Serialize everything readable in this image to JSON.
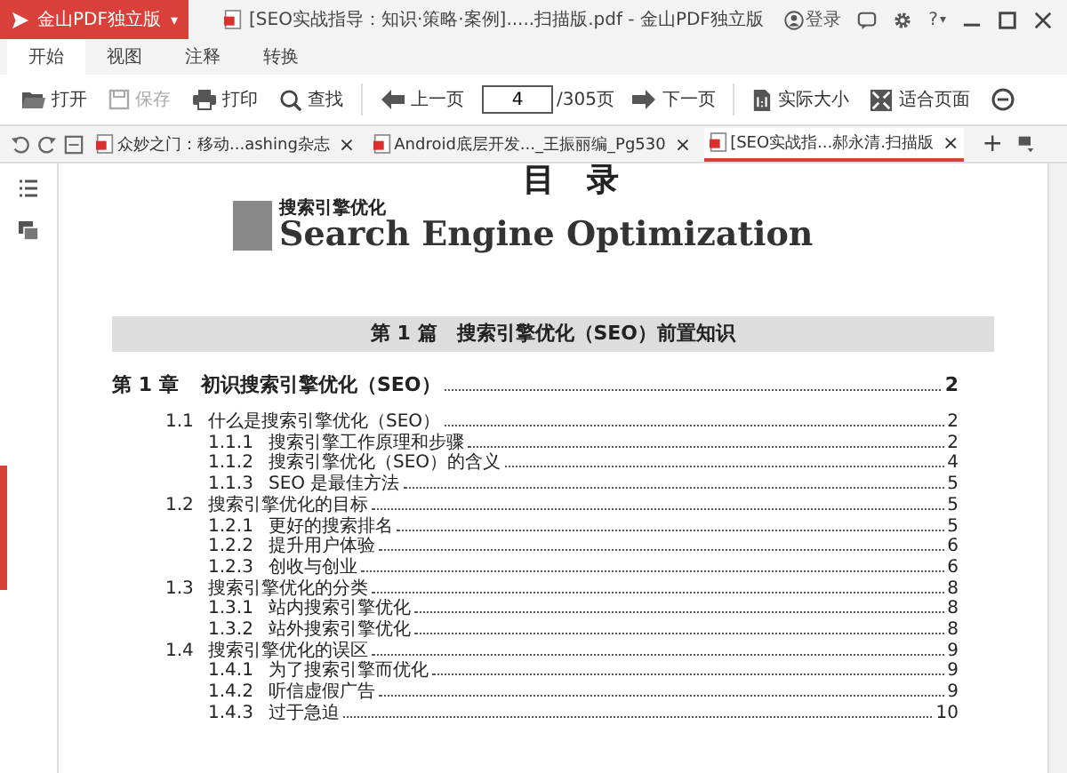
{
  "app_button": {
    "label": "金山PDF独立版",
    "caret": "▾"
  },
  "window": {
    "title": "[SEO实战指导：知识·策略·案例].....扫描版.pdf - 金山PDF独立版",
    "login": "登录",
    "help": "?",
    "help_caret": "▾"
  },
  "ribbon_tabs": [
    {
      "label": "开始",
      "selected": true
    },
    {
      "label": "视图",
      "selected": false
    },
    {
      "label": "注释",
      "selected": false
    },
    {
      "label": "转换",
      "selected": false
    }
  ],
  "toolbar": [
    {
      "kind": "open",
      "label": "打开",
      "disabled": false
    },
    {
      "kind": "save",
      "label": "保存",
      "disabled": true
    },
    {
      "kind": "print",
      "label": "打印",
      "disabled": false
    },
    {
      "kind": "find",
      "label": "查找",
      "disabled": false
    },
    {
      "kind": "prev",
      "label": "上一页",
      "disabled": false
    },
    {
      "kind": "page",
      "value": "4",
      "total": "/305页"
    },
    {
      "kind": "next",
      "label": "下一页",
      "disabled": false
    },
    {
      "kind": "actual",
      "label": "实际大小",
      "disabled": false
    },
    {
      "kind": "fit",
      "label": "适合页面",
      "disabled": false
    },
    {
      "kind": "zoomout"
    }
  ],
  "doc_tabs": [
    {
      "label": "众妙之门：移动...ashing杂志",
      "close": "×",
      "selected": false
    },
    {
      "label": "Android底层开发..._王振丽编_Pg530",
      "close": "×",
      "selected": false
    },
    {
      "label": "[SEO实战指...郝永清.扫描版",
      "close": "×",
      "selected": true
    }
  ],
  "new_tab": "+",
  "page": {
    "heading": "目　录",
    "banner_small": "搜索引擎优化",
    "banner_large": "Search Engine Optimization",
    "part": "第 1 篇　搜索引擎优化（SEO）前置知识",
    "toc": [
      {
        "number": "第 1 章",
        "title": "初识搜索引擎优化（SEO）",
        "page": "2",
        "children": [
          {
            "number": "1.1",
            "title": "什么是搜索引擎优化（SEO）",
            "page": "2",
            "children": [
              {
                "number": "1.1.1",
                "title": "搜索引擎工作原理和步骤",
                "page": "2"
              },
              {
                "number": "1.1.2",
                "title": "搜索引擎优化（SEO）的含义",
                "page": "4"
              },
              {
                "number": "1.1.3",
                "title": "SEO 是最佳方法",
                "page": "5"
              }
            ]
          },
          {
            "number": "1.2",
            "title": "搜索引擎优化的目标",
            "page": "5",
            "children": [
              {
                "number": "1.2.1",
                "title": "更好的搜索排名",
                "page": "5"
              },
              {
                "number": "1.2.2",
                "title": "提升用户体验",
                "page": "6"
              },
              {
                "number": "1.2.3",
                "title": "创收与创业",
                "page": "6"
              }
            ]
          },
          {
            "number": "1.3",
            "title": "搜索引擎优化的分类",
            "page": "8",
            "children": [
              {
                "number": "1.3.1",
                "title": "站内搜索引擎优化",
                "page": "8"
              },
              {
                "number": "1.3.2",
                "title": "站外搜索引擎优化",
                "page": "8"
              }
            ]
          },
          {
            "number": "1.4",
            "title": "搜索引擎优化的误区",
            "page": "9",
            "children": [
              {
                "number": "1.4.1",
                "title": "为了搜索引擎而优化",
                "page": "9"
              },
              {
                "number": "1.4.2",
                "title": "听信虚假广告",
                "page": "9"
              },
              {
                "number": "1.4.3",
                "title": "过于急迫",
                "page": "10"
              }
            ]
          }
        ]
      }
    ]
  }
}
